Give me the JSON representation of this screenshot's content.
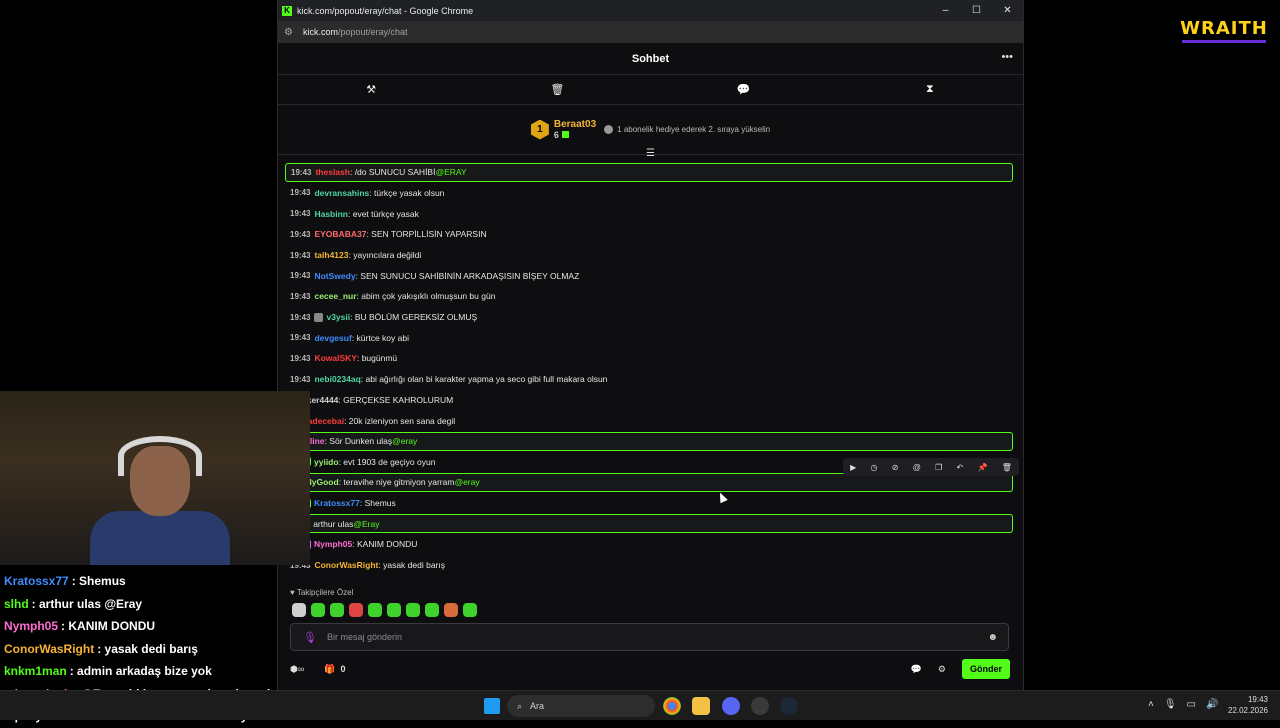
{
  "overlay_logo": "WRAITH",
  "browser": {
    "window_title": "kick.com/popout/eray/chat - Google Chrome",
    "address_host": "kick.com",
    "address_path": "/popout/eray/chat",
    "minimize": "–",
    "maximize": "☐",
    "close": "✕"
  },
  "chat_header": {
    "title": "Sohbet",
    "more": "•••"
  },
  "toolbar": [
    "hammer-icon",
    "trash-icon",
    "chat-bubble-icon",
    "hourglass-icon"
  ],
  "pinned": {
    "rank": "1",
    "user": "Beraat03",
    "count": "6",
    "gift_text": "1 abonelik hediye ederek 2. sıraya yükselin"
  },
  "messages": [
    {
      "time": "19:43",
      "user": "theslash",
      "color": "#ff3b3b",
      "text": ": /do SUNUCU SAHİBİ ",
      "mention": "@ERAY",
      "hl": true
    },
    {
      "time": "19:43",
      "user": "devransahins",
      "color": "#4fd6a3",
      "text": ": türkçe yasak olsun"
    },
    {
      "time": "19:43",
      "user": "Hasbinn",
      "color": "#4fd6a3",
      "text": ": evet türkçe yasak"
    },
    {
      "time": "19:43",
      "user": "EYOBABA37",
      "color": "#ff6b6b",
      "text": ": SEN TORPİLLİSİN YAPARSIN"
    },
    {
      "time": "19:43",
      "user": "talh4123",
      "color": "#f5b335",
      "text": ": yayıncılara değildi"
    },
    {
      "time": "19:43",
      "user": "NotSwedy",
      "color": "#3f8cff",
      "text": ": SEN SUNUCU SAHİBİNİN ARKADAŞISIN BİŞEY OLMAZ"
    },
    {
      "time": "19:43",
      "user": "cecee_nur",
      "color": "#9af06e",
      "text": ": abim çok yakışıklı olmuşsun bu gün"
    },
    {
      "time": "19:43",
      "user": "v3ysii",
      "color": "#4fd6a3",
      "text": ": BU BÖLÜM GEREKSİZ OLMUŞ",
      "badges": [
        "#888"
      ]
    },
    {
      "time": "19:43",
      "user": "devgesuf",
      "color": "#3f8cff",
      "text": ": kürtce koy abi"
    },
    {
      "time": "19:43",
      "user": "KowalSKY",
      "color": "#ff3b3b",
      "text": ": bugünmü"
    },
    {
      "time": "19:43",
      "user": "nebi0234aq",
      "color": "#4fd6a3",
      "text": ": abi ağırlığı olan bi karakter yapma ya seco gibi full makara olsun"
    },
    {
      "time": "",
      "user": "ilker4444",
      "color": "#cfcfcf",
      "text": ": GERÇEKSE KAHROLURUM",
      "badges": [
        "#4fd6a3"
      ]
    },
    {
      "time": "",
      "user": "Sadecebai",
      "color": "#ff3b3b",
      "text": ": 20k izleniyon sen sana degil",
      "badges": [
        "#e0a515"
      ]
    },
    {
      "time": "",
      "user": "Paroline",
      "color": "#ff6bd0",
      "text": ": Sör Dunken ulaş ",
      "mention": "@eray",
      "hl": true
    },
    {
      "time": "",
      "user": "yyiido",
      "color": "#9af06e",
      "text": ": evt 1903 de geçiyo oyun",
      "badges": [
        "#e0a515",
        "#53fc18"
      ]
    },
    {
      "time": "",
      "user": "SendyGood",
      "color": "#9af06e",
      "text": ": teravihe niye gitmiyon yarram ",
      "mention": "@eray",
      "hl": true
    },
    {
      "time": "",
      "user": "Kratossx77",
      "color": "#3f8cff",
      "text": ": Shemus",
      "badges": [
        "#53fc18",
        "#53fc18"
      ]
    },
    {
      "time": "",
      "user": "slhd",
      "color": "#53fc18",
      "text": ": arthur ulas ",
      "mention": "@Eray",
      "hl": true
    },
    {
      "time": "",
      "user": "Nymph05",
      "color": "#ff6bd0",
      "text": ": KANIM DONDU",
      "badges": [
        "#4fd6a3",
        "#d86bff"
      ]
    },
    {
      "time": "19:43",
      "user": "ConorWasRight",
      "color": "#f5b335",
      "text": ": yasak dedi barış"
    }
  ],
  "followers_label": "Takipçilere Özel",
  "input_placeholder": "Bir mesaj gönderin",
  "bottom": {
    "count": "0",
    "send": "Gönder"
  },
  "overlay_chat": [
    {
      "user": "Kratossx77",
      "color": "#3f8cff",
      "text": ": Shemus"
    },
    {
      "user": "slhd",
      "color": "#53fc18",
      "text": ": arthur ulas @Eray"
    },
    {
      "user": "Nymph05",
      "color": "#ff6bd0",
      "text": ": KANIM DONDU"
    },
    {
      "user": "ConorWasRight",
      "color": "#f5b335",
      "text": ": yasak dedi barış"
    },
    {
      "user": "knkm1man",
      "color": "#53fc18",
      "text": ": admin arkadaş bize yok"
    },
    {
      "user": "ademmkrsk",
      "color": "#ff6bd0",
      "text": ": @Eray abi bence yasak getirmezler e"
    },
    {
      "user": "",
      "color": "#fff",
      "text": "tepki yerler de umursalarmı bilmiom ama yine"
    }
  ],
  "taskbar": {
    "search": "Ara",
    "time": "19:43",
    "date": "22.02.2026"
  }
}
